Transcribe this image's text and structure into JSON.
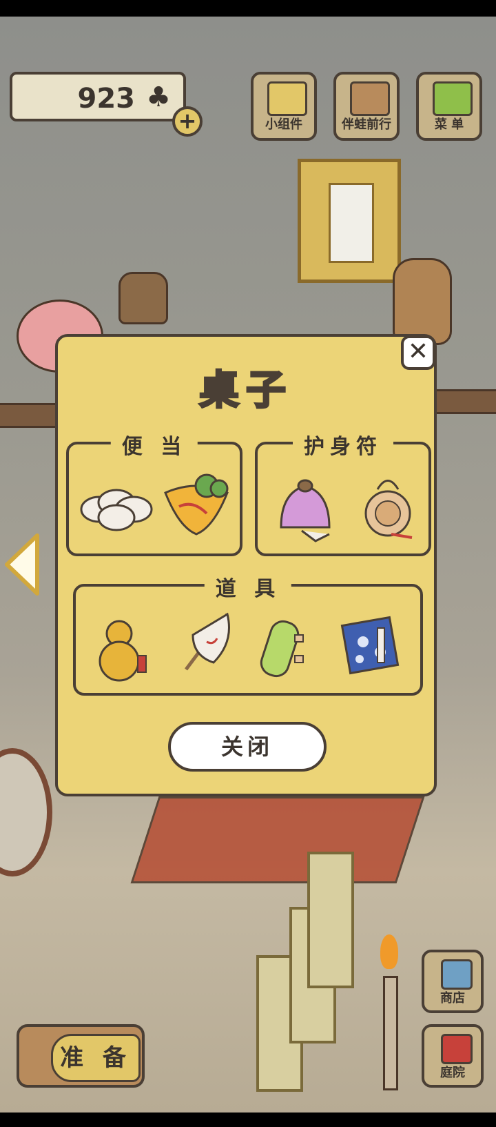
{
  "currency": {
    "amount": "923",
    "icon": "clover-icon"
  },
  "top_buttons": {
    "widgets": "小组件",
    "travel": "伴蛙前行",
    "menu": "菜 单"
  },
  "side_buttons": {
    "shop": "商店",
    "garden": "庭院"
  },
  "prepare": "准 备",
  "modal": {
    "title": "桌子",
    "groups": {
      "bento": "便 当",
      "charm": "护身符",
      "tools": "道 具"
    },
    "close": "关闭"
  },
  "colors": {
    "panel": "#ecd477",
    "outline": "#4a3f35",
    "button_face": "#c7b48a"
  }
}
